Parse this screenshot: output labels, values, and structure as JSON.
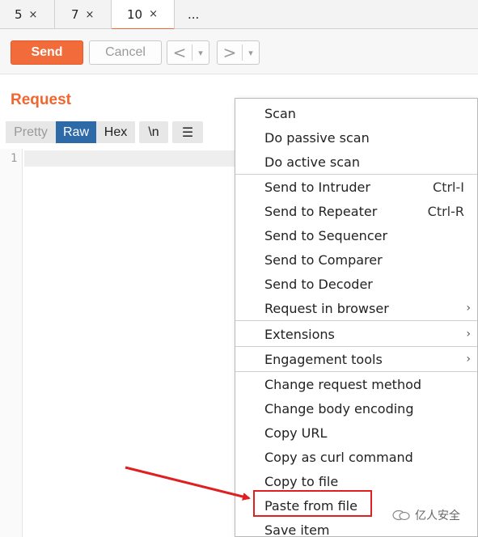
{
  "tabs": [
    {
      "label": "5",
      "close": "×"
    },
    {
      "label": "7",
      "close": "×"
    },
    {
      "label": "10",
      "close": "×"
    }
  ],
  "tab_more": "...",
  "toolbar": {
    "send_label": "Send",
    "cancel_label": "Cancel",
    "back_glyph": "<",
    "forward_glyph": ">",
    "dropdown_glyph": "▾"
  },
  "request": {
    "title": "Request",
    "view_buttons": [
      "Pretty",
      "Raw",
      "Hex",
      "\\n"
    ],
    "menu_glyph": "☰",
    "line_number": "1"
  },
  "context_menu": {
    "items": [
      {
        "label": "Scan"
      },
      {
        "label": "Do passive scan"
      },
      {
        "label": "Do active scan"
      },
      {
        "label": "Send to Intruder",
        "shortcut": "Ctrl-I"
      },
      {
        "label": "Send to Repeater",
        "shortcut": "Ctrl-R"
      },
      {
        "label": "Send to Sequencer"
      },
      {
        "label": "Send to Comparer"
      },
      {
        "label": "Send to Decoder"
      },
      {
        "label": "Request in browser",
        "submenu": "›"
      },
      {
        "label": "Extensions",
        "submenu": "›"
      },
      {
        "label": "Engagement tools",
        "submenu": "›"
      },
      {
        "label": "Change request method"
      },
      {
        "label": "Change body encoding"
      },
      {
        "label": "Copy URL"
      },
      {
        "label": "Copy as curl command"
      },
      {
        "label": "Copy to file"
      },
      {
        "label": "Paste from file"
      },
      {
        "label": "Save item"
      }
    ],
    "highlighted_item": "Paste from file"
  },
  "watermark": {
    "text": "亿人安全"
  },
  "colors": {
    "accent": "#f0662e",
    "send_button": "#f26b3a",
    "raw_active": "#2e6aa8",
    "annotation_red": "#e02020"
  }
}
